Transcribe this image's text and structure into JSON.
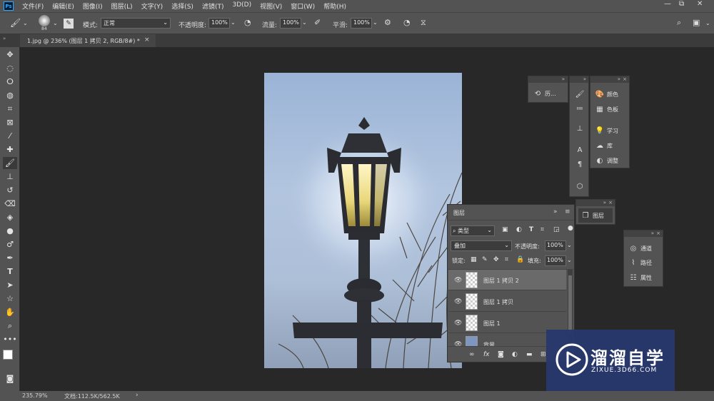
{
  "menu": {
    "logo": "Ps",
    "items": [
      "文件(F)",
      "编辑(E)",
      "图像(I)",
      "图层(L)",
      "文字(Y)",
      "选择(S)",
      "滤镜(T)",
      "3D(D)",
      "视图(V)",
      "窗口(W)",
      "帮助(H)"
    ]
  },
  "options": {
    "brush_size": "84",
    "mode_label": "模式:",
    "mode_value": "正常",
    "opacity_label": "不透明度:",
    "opacity_value": "100%",
    "flow_label": "流量:",
    "flow_value": "100%",
    "smooth_label": "平滑:",
    "smooth_value": "100%"
  },
  "document": {
    "tab_title": "1.jpg @ 236% (图层 1 拷贝 2, RGB/8#) *",
    "close": "×"
  },
  "panels": {
    "history_label": "历...",
    "color": "颜色",
    "swatches": "色板",
    "learn": "学习",
    "libraries": "库",
    "adjustments": "调整",
    "layers_collapsed": "图层",
    "channels": "通道",
    "paths": "路径",
    "properties": "属性"
  },
  "layers_panel": {
    "title": "图层",
    "filter_kind": "类型",
    "blend_mode": "叠加",
    "opacity_label": "不透明度:",
    "opacity_value": "100%",
    "lock_label": "锁定:",
    "fill_label": "填充:",
    "fill_value": "100%",
    "layers": [
      {
        "name": "图层 1 拷贝 2",
        "selected": true
      },
      {
        "name": "图层 1 拷贝",
        "selected": false
      },
      {
        "name": "图层 1",
        "selected": false
      },
      {
        "name": "背景",
        "selected": false
      }
    ],
    "fx": "fx"
  },
  "status": {
    "zoom": "235.79%",
    "doc_size": "文档:112.5K/562.5K"
  },
  "watermark": {
    "brand": "溜溜自学",
    "url": "ZIXUE.3D66.COM"
  }
}
